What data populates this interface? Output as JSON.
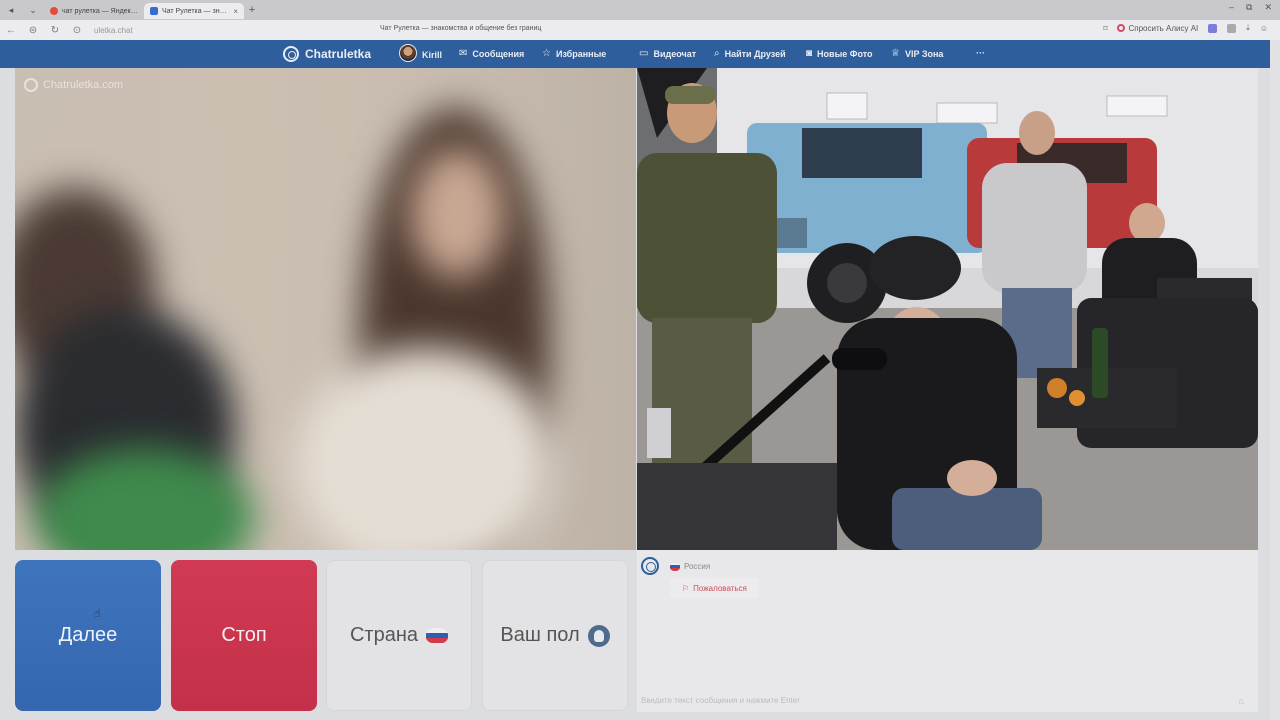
{
  "browser": {
    "tabs": [
      {
        "title": "чат рулетка — Яндекс: нашлось"
      },
      {
        "title": "Чат Рулетка — знакомства и общение без границ"
      }
    ],
    "url": "uletka.chat",
    "page_title": "Чат Рулетка — знакомства и общение без границ",
    "alice_label": "Спросить Алису AI"
  },
  "header": {
    "logo_text": "Chatruletka",
    "user_name": "Kirill",
    "nav": {
      "messages": "Сообщения",
      "favorites": "Избранные",
      "videochat": "Видеочат",
      "find_friends": "Найти Друзей",
      "new_photos": "Новые Фото",
      "vip": "VIP Зона",
      "more": "···"
    }
  },
  "video": {
    "watermark": "Chatruletka.com"
  },
  "controls": {
    "next": "Далее",
    "stop": "Стоп",
    "country": "Страна",
    "gender": "Ваш пол"
  },
  "chat": {
    "country": "Россия",
    "report": "Пожаловаться",
    "input_placeholder": "Введите текст сообщения и нажмите Enter"
  },
  "colors": {
    "header": "#2f5e9c",
    "next_button": "#3566b0",
    "stop_button": "#c4304a",
    "report_text": "#cc4a5c"
  },
  "icons": [
    "chatruletka-logo-icon",
    "messages-icon",
    "star-icon",
    "video-icon",
    "search-icon",
    "camera-icon",
    "crown-icon",
    "more-icon",
    "flag-russia-icon",
    "report-flag-icon",
    "gender-avatar-icon"
  ]
}
